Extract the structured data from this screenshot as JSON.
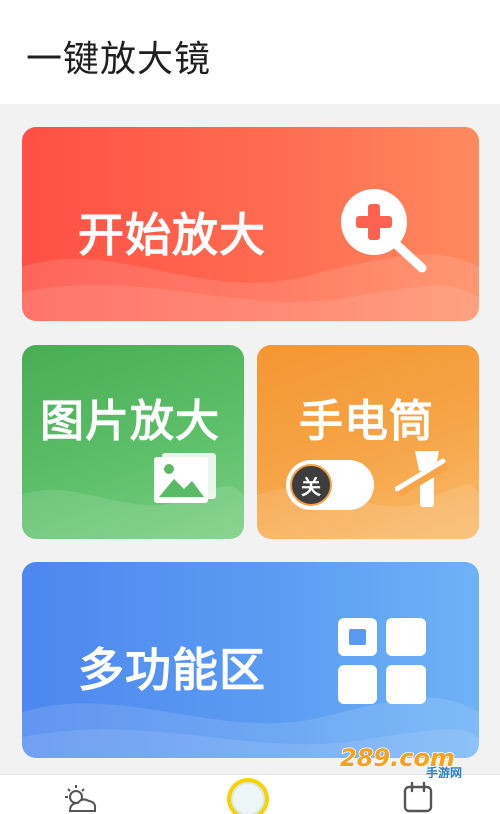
{
  "header": {
    "title": "一键放大镜"
  },
  "cards": {
    "start": {
      "label": "开始放大",
      "icon": "zoom-in-icon"
    },
    "photo": {
      "label": "图片放大",
      "icon": "image-icon"
    },
    "flashlight": {
      "label": "手电筒",
      "toggle_label": "关",
      "toggle_state": "off",
      "icon": "flashlight-off-icon"
    },
    "multi": {
      "label": "多功能区",
      "icon": "grid-icon"
    }
  },
  "tabbar": {
    "items": [
      {
        "icon": "weather-icon"
      },
      {
        "icon": "magnifier-icon",
        "active": true
      },
      {
        "icon": "calendar-icon"
      }
    ]
  },
  "watermark": {
    "text": "289.com",
    "subtext": "手游网"
  },
  "colors": {
    "red": "#ff5a48",
    "green": "#55b760",
    "orange": "#f49a3a",
    "blue": "#5591f0",
    "tab_active": "#f5d400"
  }
}
